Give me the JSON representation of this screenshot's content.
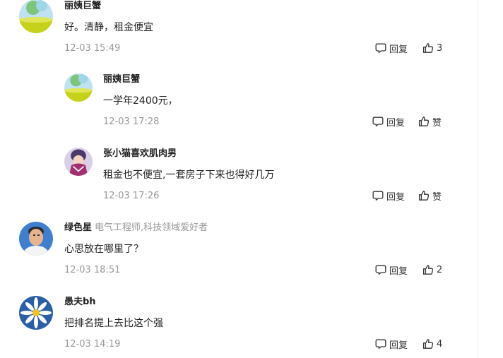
{
  "comments": [
    {
      "username": "丽姨巨蟹",
      "user_title": "",
      "text": "好。清静，租金便宜",
      "time": "12-03 15:49",
      "reply_label": "回复",
      "like_label": "3",
      "avatar_icon": "landscape-avatar-icon"
    },
    {
      "username": "丽姨巨蟹",
      "user_title": "",
      "text": "一学年2400元，",
      "time": "12-03 17:28",
      "reply_label": "回复",
      "like_label": "赞",
      "avatar_icon": "landscape-avatar-icon"
    },
    {
      "username": "张小猫喜欢肌肉男",
      "user_title": "",
      "text": "租金也不便宜,一套房子下来也得好几万",
      "time": "12-03 17:26",
      "reply_label": "回复",
      "like_label": "赞",
      "avatar_icon": "anime-avatar-icon"
    },
    {
      "username": "绿色星",
      "user_title": "电气工程师,科技领域爱好者",
      "text": "心思放在哪里了？",
      "time": "12-03 18:51",
      "reply_label": "回复",
      "like_label": "2",
      "avatar_icon": "portrait-avatar-icon"
    },
    {
      "username": "愚夫bh",
      "user_title": "",
      "text": "把排名提上去比这个强",
      "time": "12-03 14:19",
      "reply_label": "回复",
      "like_label": "4",
      "avatar_icon": "daisy-avatar-icon"
    }
  ],
  "colors": {
    "primary_text": "#222222",
    "secondary_text": "#999999",
    "action_text": "#333333"
  },
  "icons": {
    "reply": "comment-bubble-icon",
    "like": "thumbs-up-icon"
  }
}
